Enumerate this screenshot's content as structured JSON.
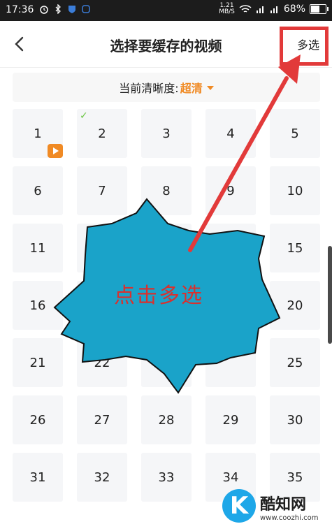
{
  "status_bar": {
    "time": "17:36",
    "net_speed_value": "1.21",
    "net_speed_unit": "MB/S",
    "battery": "68%",
    "battery_level": 0.68
  },
  "header": {
    "title": "选择要缓存的视频",
    "multi_select_label": "多选"
  },
  "quality": {
    "label": "当前清晰度:",
    "value": "超清"
  },
  "episodes": [
    "1",
    "2",
    "3",
    "4",
    "5",
    "6",
    "7",
    "8",
    "9",
    "10",
    "11",
    "",
    "",
    "",
    "15",
    "16",
    "",
    "",
    "",
    "20",
    "21",
    "22",
    "",
    "",
    "25",
    "26",
    "27",
    "28",
    "29",
    "30",
    "31",
    "32",
    "33",
    "34",
    "35"
  ],
  "overlay": {
    "callout_text": "点击多选"
  },
  "watermark": {
    "logo_letter": "K",
    "name": "酷知网",
    "url": "www.coozhi.com"
  },
  "colors": {
    "accent_orange": "#f08a24",
    "annotation_red": "#e23a3a",
    "burst_fill": "#1aa3c9"
  }
}
